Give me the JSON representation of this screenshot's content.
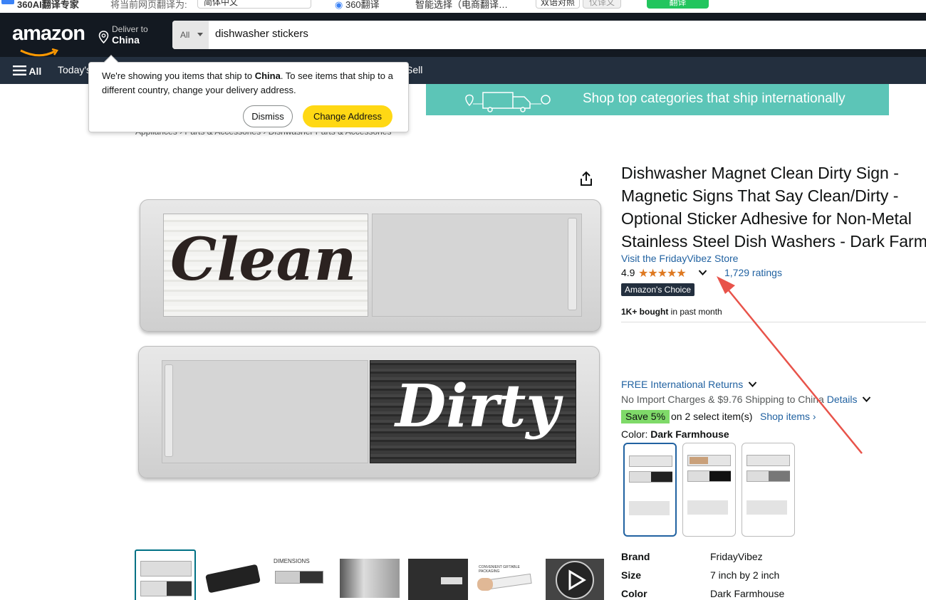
{
  "toolbar": {
    "app_name": "360AI翻译专家",
    "translate_to_label": "将当前网页翻译为:",
    "language_value": "简体中文",
    "engine": "360翻译",
    "mode": "智能选择（电商翻译…",
    "view_bilingual": "双语对照",
    "view_translated": "仅译文",
    "translate_button": "翻译"
  },
  "nav": {
    "logo": "amazon",
    "deliver_to_label": "Deliver to",
    "deliver_to_country": "China",
    "search_category": "All",
    "search_query": "dishwasher stickers",
    "menu_all": "All",
    "todays_deals": "Today's",
    "sell": "Sell"
  },
  "popover": {
    "text_1": "We're showing you items that ship to ",
    "country": "China",
    "text_2": ". To see items that ship to a different country, change your delivery address.",
    "dismiss_label": "Dismiss",
    "change_label": "Change Address"
  },
  "banner": {
    "text": "Shop top categories that ship internationally"
  },
  "breadcrumb": "Appliances › Parts & Accessories › Dishwasher Parts & Accessories",
  "product": {
    "title_lines": [
      "Dishwasher Magnet Clean Dirty Sign -",
      "Magnetic Signs That Say Clean/Dirty -",
      "Optional Sticker Adhesive for Non-Metal",
      "Stainless Steel Dish Washers - Dark Farmhouse"
    ],
    "store_link": "Visit the FridayVibez Store",
    "rating_value": "4.9",
    "stars": 5,
    "ratings_count": "1,729 ratings",
    "badge": "Amazon's Choice",
    "bought_bold": "1K+ bought",
    "bought_rest": " in past month",
    "returns": "FREE International Returns",
    "shipping": "No Import Charges & $9.76 Shipping to China ",
    "shipping_details": "Details",
    "save_badge": "Save 5%",
    "save_text": "on 2 select item(s)",
    "shop_items": "Shop items ›",
    "color_label": "Color: ",
    "color_value": "Dark Farmhouse",
    "image_word_1": "Clean",
    "image_word_2": "Dirty",
    "thumb_dimensions_label": "DIMENSIONS",
    "thumb_packaging_label": "CONVENIENT GIFTABLE PACKAGING",
    "specs": [
      {
        "key": "Brand",
        "value": "FridayVibez"
      },
      {
        "key": "Size",
        "value": "7 inch by 2 inch"
      },
      {
        "key": "Color",
        "value": "Dark Farmhouse"
      }
    ]
  },
  "colors": {
    "nav_bg": "#131921",
    "subnav_bg": "#232f3e",
    "link": "#2162a1",
    "star": "#de7921",
    "change_button": "#ffd814",
    "save_badge": "#7fda69",
    "banner": "#5cc5b7",
    "annotation_arrow": "#e8534a"
  }
}
